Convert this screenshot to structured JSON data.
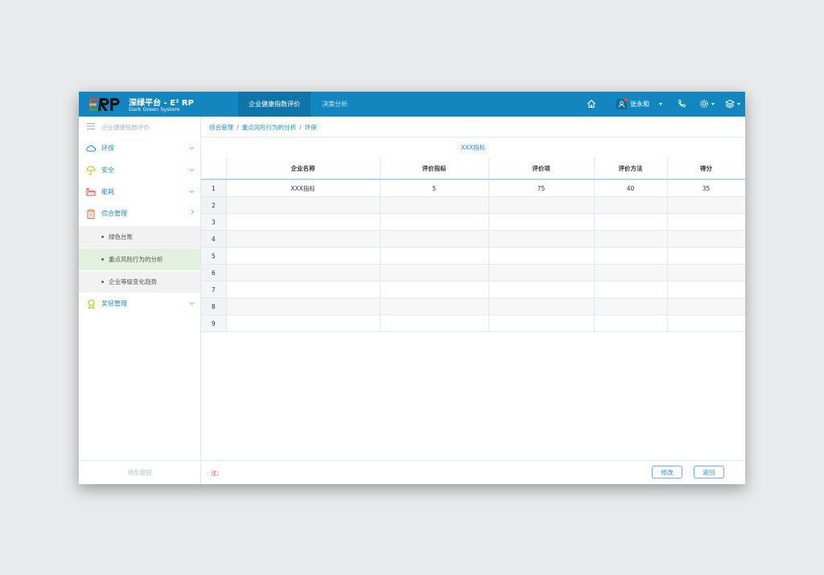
{
  "header": {
    "brand_title": "深绿平台 - E² RP",
    "brand_subtitle": "Dark Green System",
    "tabs": [
      {
        "label": "企业健康指数评价",
        "active": true
      },
      {
        "label": "决策分析",
        "active": false
      }
    ],
    "user_name": "张永和",
    "icons": [
      "home-icon",
      "user-icon",
      "phone-icon",
      "settings-icon",
      "layers-icon"
    ]
  },
  "sidebar": {
    "header_label": "企业健康指数评价",
    "items": [
      {
        "label": "环保",
        "icon": "cloud-icon",
        "color": "#1c8ec8"
      },
      {
        "label": "安全",
        "icon": "umbrella-icon",
        "color": "#d8b400"
      },
      {
        "label": "能耗",
        "icon": "factory-icon",
        "color": "#e2463a"
      },
      {
        "label": "综合管理",
        "icon": "clipboard-icon",
        "color": "#e56a2a",
        "expanded": true,
        "children": [
          {
            "label": "绿色台账"
          },
          {
            "label": "重点风险行为的分析",
            "active": true
          },
          {
            "label": "企业等级变化趋势"
          }
        ]
      },
      {
        "label": "奖惩管理",
        "icon": "award-icon",
        "color": "#b9c200"
      }
    ],
    "footer_label": "待示按钮"
  },
  "main": {
    "breadcrumb": [
      "综合管理",
      "重点风险行为的分析",
      "环保"
    ],
    "table_caption": "XXX指标",
    "columns": [
      "",
      "企业名称",
      "评价指标",
      "评价项",
      "评价方法",
      "得分"
    ],
    "rows": [
      [
        "1",
        "XXX指标",
        "5",
        "75",
        "40",
        "35"
      ],
      [
        "2",
        "",
        "",
        "",
        "",
        ""
      ],
      [
        "3",
        "",
        "",
        "",
        "",
        ""
      ],
      [
        "4",
        "",
        "",
        "",
        "",
        ""
      ],
      [
        "5",
        "",
        "",
        "",
        "",
        ""
      ],
      [
        "6",
        "",
        "",
        "",
        "",
        ""
      ],
      [
        "7",
        "",
        "",
        "",
        "",
        ""
      ],
      [
        "8",
        "",
        "",
        "",
        "",
        ""
      ],
      [
        "9",
        "",
        "",
        "",
        "",
        ""
      ]
    ],
    "note_label": "注：",
    "edit_button": "修改",
    "back_button": "返回"
  },
  "colors": {
    "topbar": "#1386bf",
    "active_tab": "#0f74a8",
    "accent": "#1c8ec8",
    "active_submenu": "#e2f0de"
  }
}
